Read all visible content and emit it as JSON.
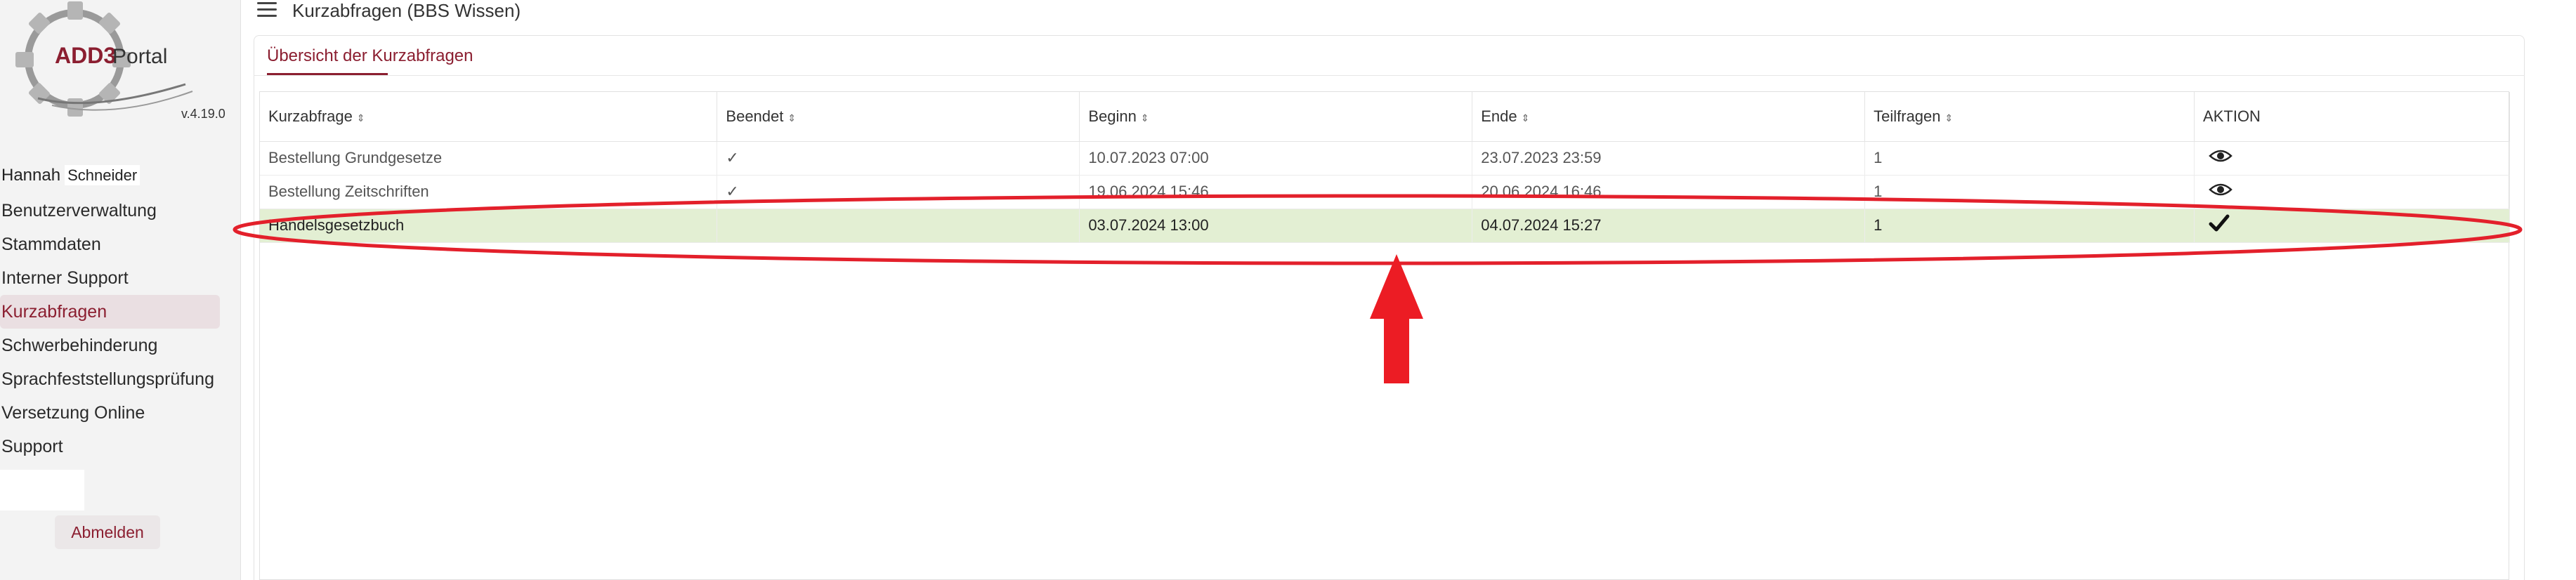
{
  "brand": {
    "logo_text": "ADD3Portal",
    "version": "v.4.19.0"
  },
  "user": {
    "first_name": "Hannah",
    "last_name": "Schneider"
  },
  "sidebar": {
    "items": [
      {
        "label": "Benutzerverwaltung",
        "active": false
      },
      {
        "label": "Stammdaten",
        "active": false
      },
      {
        "label": "Interner Support",
        "active": false
      },
      {
        "label": "Kurzabfragen",
        "active": true
      },
      {
        "label": "Schwerbehinderung",
        "active": false
      },
      {
        "label": "Sprachfeststellungsprüfung",
        "active": false
      },
      {
        "label": "Versetzung Online",
        "active": false
      },
      {
        "label": "Support",
        "active": false
      }
    ],
    "logout_label": "Abmelden"
  },
  "header": {
    "title": "Kurzabfragen (BBS Wissen)"
  },
  "main": {
    "tab_label": "Übersicht der Kurzabfragen",
    "table": {
      "columns": [
        "Kurzabfrage",
        "Beendet",
        "Beginn",
        "Ende",
        "Teilfragen",
        "AKTION"
      ],
      "rows": [
        {
          "name": "Bestellung Grundgesetze",
          "beendet": "✓",
          "beginn": "10.07.2023 07:00",
          "ende": "23.07.2023 23:59",
          "teilfragen": "1",
          "aktion_icon": "eye-icon",
          "highlighted": false
        },
        {
          "name": "Bestellung Zeitschriften",
          "beendet": "✓",
          "beginn": "19.06.2024 15:46",
          "ende": "20.06.2024 16:46",
          "teilfragen": "1",
          "aktion_icon": "eye-icon",
          "highlighted": false
        },
        {
          "name": "Handelsgesetzbuch",
          "beendet": "",
          "beginn": "03.07.2024 13:00",
          "ende": "04.07.2024 15:27",
          "teilfragen": "1",
          "aktion_icon": "checkmark-icon",
          "highlighted": true
        }
      ]
    }
  },
  "colors": {
    "accent": "#8b1e30",
    "highlight_row": "#e3efd3",
    "annotation": "#e3202b"
  }
}
